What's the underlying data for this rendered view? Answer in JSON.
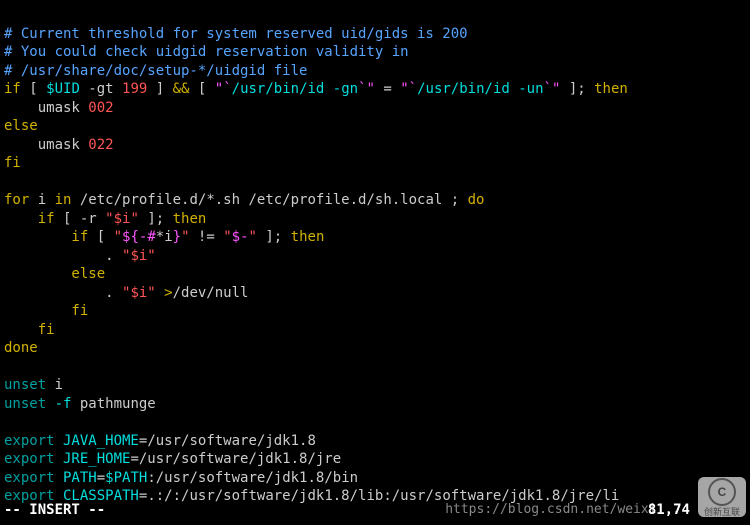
{
  "lines": {
    "c1": "# Current threshold for system reserved uid/gids is 200",
    "c2": "# You could check uidgid reservation validity in",
    "c3": "# /usr/share/doc/setup-*/uidgid file",
    "if": "if",
    "lb": " [ ",
    "uidvar": "$UID",
    "gt": " -gt ",
    "n199": "199",
    "rb": " ] ",
    "andand": "&&",
    "lb2": " [ ",
    "bq1": "\"`",
    "cmd1": "/usr/bin/id -gn",
    "bq2": "`\"",
    "eq": " = ",
    "bq3": "\"`",
    "cmd2": "/usr/bin/id -un",
    "bq4": "`\"",
    "rb2": " ]; ",
    "then": "then",
    "umask1pre": "    umask ",
    "umask1": "002",
    "else": "else",
    "umask2pre": "    umask ",
    "umask2": "022",
    "fi": "fi",
    "for": "for",
    "i": " i ",
    "in": "in",
    "globs": " /etc/profile.d/*.sh /etc/profile.d/sh.local ; ",
    "do": "do",
    "if2": "    if",
    "lb3": " [ ",
    "rflag": "-r ",
    "qsi": "\"$i\"",
    "rb3": " ]; ",
    "then2": "then",
    "if3": "        if",
    "lb4": " [ ",
    "q1": "\"",
    "pex": "${-#",
    "star": "*",
    "iref": "i",
    "pexend": "}",
    "q2": "\"",
    "neq": " != ",
    "q3": "\"",
    "dash": "$-",
    "q4": "\"",
    "rb4": " ]; ",
    "then3": "then",
    "dot1": "            . ",
    "qsi2": "\"$i\"",
    "else2": "        else",
    "dot2": "            . ",
    "qsi3": "\"$i\"",
    "redir": " >",
    "devnull": "/dev/null",
    "fi2": "        fi",
    "fi3": "    fi",
    "done": "done",
    "unset": "unset",
    "ivar": " i",
    "unset2": "unset",
    "fflag": " -f ",
    "pm": "pathmunge",
    "export": "export",
    "jh": " JAVA_HOME",
    "eq1": "=",
    "jhv": "/usr/software/jdk1.8",
    "jr": " JRE_HOME",
    "jrv": "/usr/software/jdk1.8/jre",
    "pa": " PATH",
    "pav1": "$PATH",
    "pav2": ":/usr/software/jdk1.8/bin",
    "cp": " CLASSPATH",
    "cpv": ".:/:/usr/software/jdk1.8/lib:/usr/software/jdk1.8/jre/li"
  },
  "status": {
    "mode": "-- INSERT --",
    "pos": "81,74"
  },
  "watermark": {
    "url": "https://blog.csdn.net/weixi...",
    "badge": "创新互联",
    "badgeC": "C"
  }
}
